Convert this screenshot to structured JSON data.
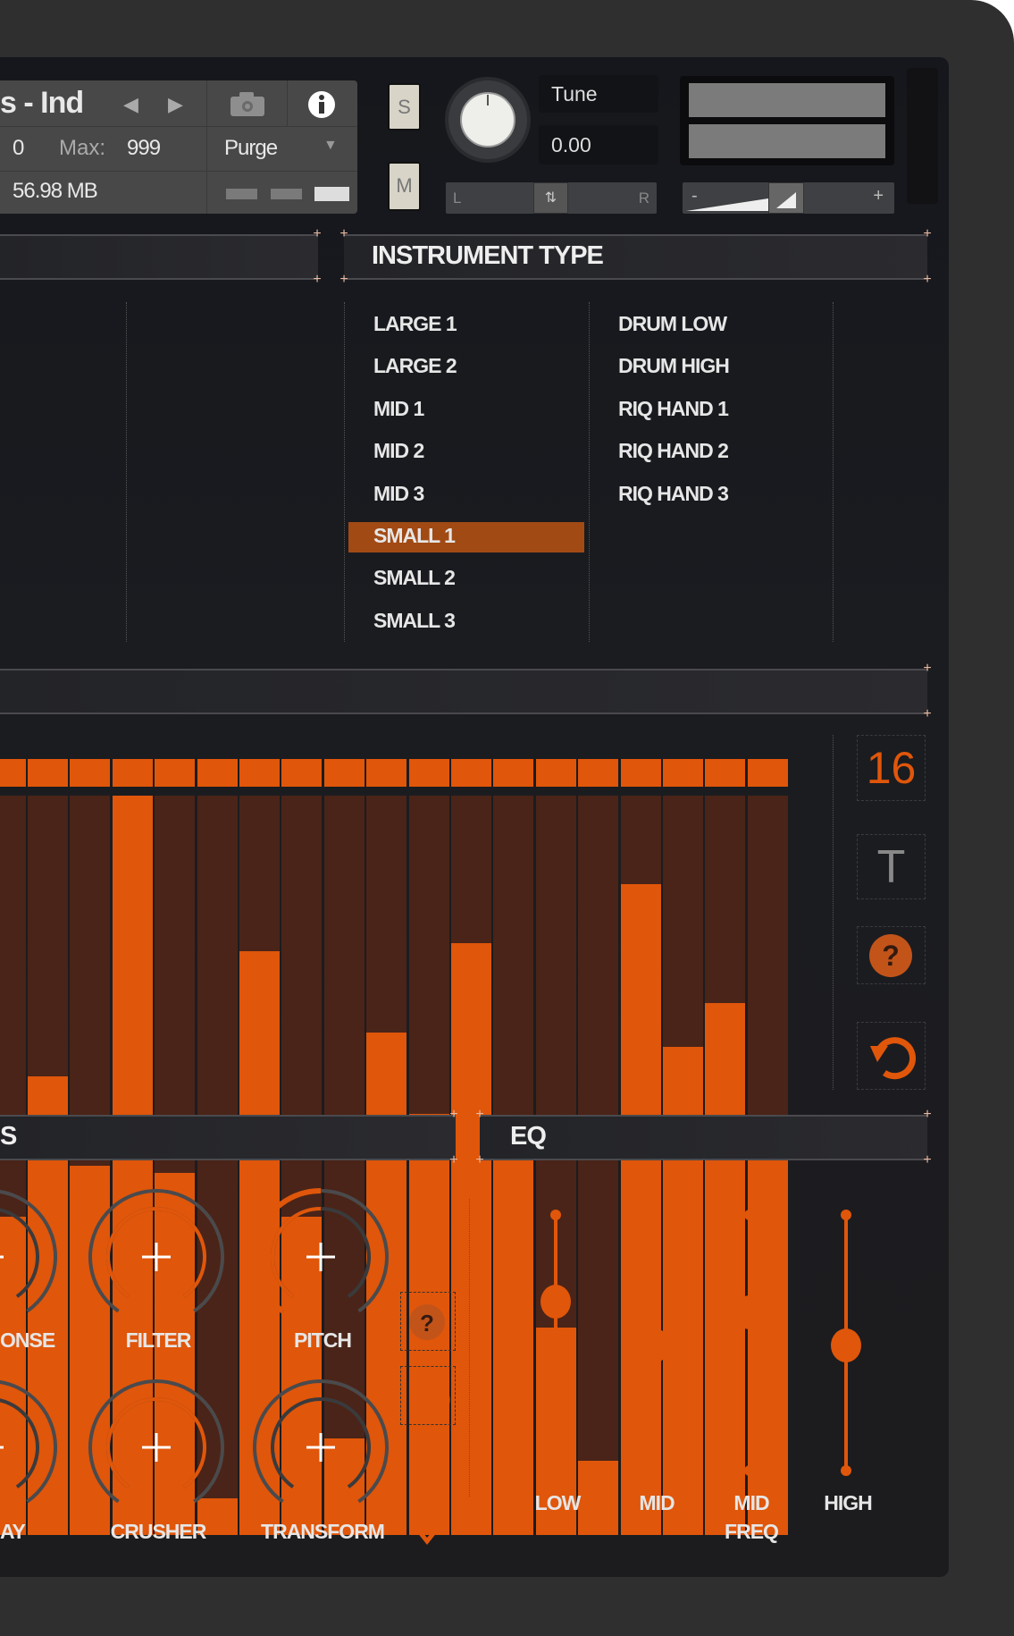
{
  "header": {
    "instrument_name": "s - Ind",
    "prev_icon": "chevron-left-icon",
    "next_icon": "chevron-right-icon",
    "camera_icon": "camera-icon",
    "info_icon": "info-icon",
    "voices": "0",
    "max_label": "Max:",
    "max_value": "999",
    "purge_label": "Purge",
    "memory": "56.98 MB",
    "solo_label": "S",
    "mute_label": "M",
    "tune_label": "Tune",
    "tune_value": "0.00",
    "pan_left": "L",
    "pan_right": "R",
    "vol_minus": "-",
    "vol_plus": "+"
  },
  "instrument_type": {
    "title": "INSTRUMENT TYPE",
    "column1": [
      "LARGE 1",
      "LARGE 2",
      "MID 1",
      "MID 2",
      "MID 3",
      "SMALL 1",
      "SMALL 2",
      "SMALL 3"
    ],
    "column2": [
      "DRUM LOW",
      "DRUM HIGH",
      "RIQ HAND 1",
      "RIQ HAND 2",
      "RIQ HAND 3"
    ],
    "selected": "SMALL 1"
  },
  "sequencer": {
    "step_values": [
      0.43,
      0.62,
      0.5,
      1.0,
      0.49,
      0.05,
      0.79,
      0.43,
      0.13,
      0.68,
      0.57,
      0.8,
      0.54,
      0.28,
      0.1,
      0.88,
      0.66,
      0.72,
      0.54
    ],
    "steps_count": "16",
    "text_button": "T",
    "help_icon": "help-icon",
    "reset_icon": "reset-icon"
  },
  "effects": {
    "title_fragment": "S",
    "knobs_row1": [
      {
        "label": "ONSE",
        "outer": 0,
        "inner": 0
      },
      {
        "label": "FILTER",
        "outer": 0,
        "inner": 1
      },
      {
        "label": "PITCH",
        "outer": 0.5,
        "inner": 0.5
      }
    ],
    "knobs_row2": [
      {
        "label": "AY",
        "outer": 0,
        "inner": 0
      },
      {
        "label": "CRUSHER",
        "outer": 0,
        "inner": 1
      },
      {
        "label": "TRANSFORM",
        "outer": 0,
        "inner": 0
      }
    ],
    "transform_icon": "chevron-down-icon"
  },
  "eq": {
    "title": "EQ",
    "bands": [
      {
        "label": "LOW",
        "value": 0.66
      },
      {
        "label": "MID",
        "value": 0.49
      },
      {
        "label": "MID FREQ",
        "value": 0.62
      },
      {
        "label": "HIGH",
        "value": 0.49
      }
    ]
  },
  "colors": {
    "accent": "#e0560a",
    "accent_dark": "#4a2418",
    "selected": "#a14a14"
  }
}
